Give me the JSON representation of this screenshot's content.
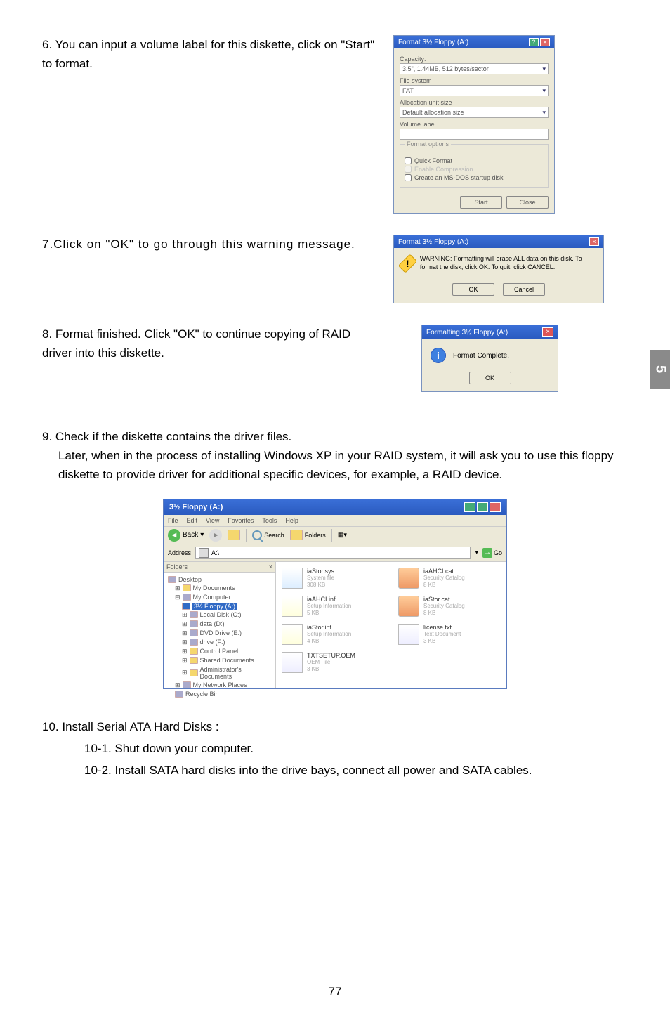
{
  "sideTab": "5",
  "pageNumber": "77",
  "steps": {
    "s6": "6. You can input a volume label for this diskette, click on \"Start\" to format.",
    "s7": "7.Click on \"OK\" to go through this warning message.",
    "s8": "8. Format finished. Click \"OK\" to continue copying of RAID driver into this diskette.",
    "s9a": "9. Check if the diskette contains the driver files.",
    "s9b": "Later, when in the process of installing Windows XP in your RAID system, it will ask you to use this floppy diskette to provide driver for additional specific devices, for example, a RAID device.",
    "s10": "10. Install Serial ATA Hard Disks :",
    "s10_1": "10-1. Shut down your computer.",
    "s10_2": "10-2. Install SATA hard disks into the drive bays, connect all power and SATA cables."
  },
  "formatDlg": {
    "title": "Format 3½ Floppy (A:)",
    "capacityLbl": "Capacity:",
    "capacityVal": "3.5\", 1.44MB, 512 bytes/sector",
    "fsLbl": "File system",
    "fsVal": "FAT",
    "allocLbl": "Allocation unit size",
    "allocVal": "Default allocation size",
    "volLbl": "Volume label",
    "optTitle": "Format options",
    "quick": "Quick Format",
    "comp": "Enable Compression",
    "msdos": "Create an MS-DOS startup disk",
    "start": "Start",
    "close": "Close"
  },
  "warnDlg": {
    "title": "Format 3½ Floppy (A:)",
    "text": "WARNING: Formatting will erase ALL data on this disk. To format the disk, click OK. To quit, click CANCEL.",
    "ok": "OK",
    "cancel": "Cancel"
  },
  "doneDlg": {
    "title": "Formatting 3½ Floppy (A:)",
    "text": "Format Complete.",
    "ok": "OK"
  },
  "explorer": {
    "title": "3½ Floppy (A:)",
    "menu": [
      "File",
      "Edit",
      "View",
      "Favorites",
      "Tools",
      "Help"
    ],
    "back": "Back",
    "search": "Search",
    "folders": "Folders",
    "addrLbl": "Address",
    "addrVal": "A:\\",
    "go": "Go",
    "treeHdr": "Folders",
    "tree": {
      "desktop": "Desktop",
      "mydocs": "My Documents",
      "mycomp": "My Computer",
      "floppy": "3½ Floppy (A:)",
      "localc": "Local Disk (C:)",
      "data": "data (D:)",
      "dvd": "DVD Drive (E:)",
      "drivef": "drive (F:)",
      "ctrl": "Control Panel",
      "shared": "Shared Documents",
      "admin": "Administrator's Documents",
      "netpl": "My Network Places",
      "recycle": "Recycle Bin"
    },
    "files": [
      {
        "name": "iaStor.sys",
        "sub": "System file",
        "sub2": "308 KB",
        "ic": "sys"
      },
      {
        "name": "iaAHCI.cat",
        "sub": "Security Catalog",
        "sub2": "8 KB",
        "ic": "cat"
      },
      {
        "name": "iaAHCI.inf",
        "sub": "Setup Information",
        "sub2": "5 KB",
        "ic": "inf"
      },
      {
        "name": "iaStor.cat",
        "sub": "Security Catalog",
        "sub2": "8 KB",
        "ic": "cat"
      },
      {
        "name": "iaStor.inf",
        "sub": "Setup Information",
        "sub2": "4 KB",
        "ic": "inf"
      },
      {
        "name": "license.txt",
        "sub": "Text Document",
        "sub2": "3 KB",
        "ic": "txt"
      },
      {
        "name": "TXTSETUP.OEM",
        "sub": "OEM File",
        "sub2": "3 KB",
        "ic": "txt"
      }
    ]
  }
}
